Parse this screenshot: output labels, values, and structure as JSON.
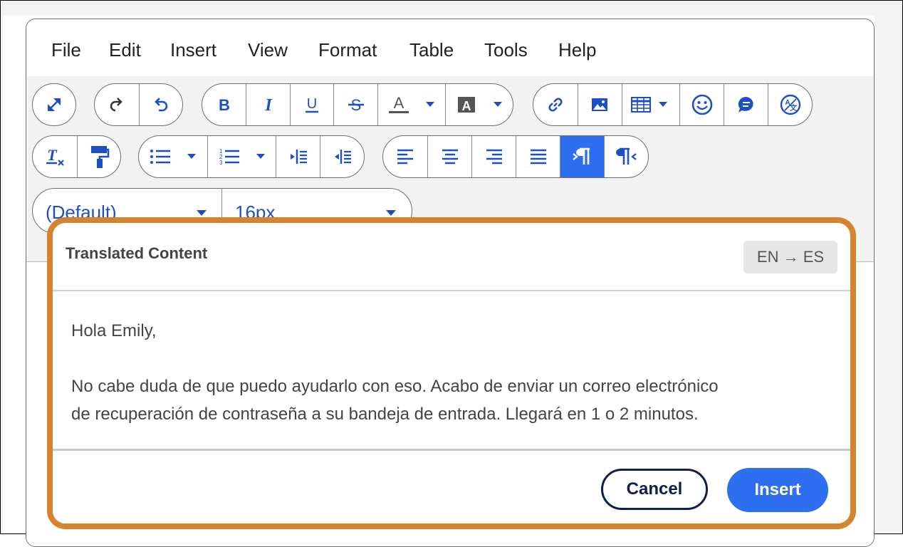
{
  "menu": {
    "items": [
      "File",
      "Edit",
      "Insert",
      "View",
      "Format",
      "Table",
      "Tools",
      "Help"
    ]
  },
  "toolbar": {
    "row1": [
      "fullscreen-icon",
      "redo-icon",
      "undo-icon",
      "bold-icon",
      "italic-icon",
      "underline-icon",
      "strikethrough-icon",
      "text-color-icon",
      "highlight-color-icon",
      "link-icon",
      "image-icon",
      "table-icon",
      "emoji-icon",
      "comment-icon",
      "translate-icon"
    ],
    "row2": [
      "clear-formatting-icon",
      "format-painter-icon",
      "bullet-list-icon",
      "numbered-list-icon",
      "indent-icon",
      "outdent-icon",
      "align-left-icon",
      "align-center-icon",
      "align-right-icon",
      "justify-icon",
      "ltr-icon",
      "rtl-icon"
    ],
    "font_family": "(Default)",
    "font_size": "16px",
    "active_button": "ltr-icon"
  },
  "dialog": {
    "title": "Translated Content",
    "language_badge": "EN → ES",
    "greeting": "Hola Emily,",
    "body_line1": "No cabe duda de que puedo ayudarlo con eso. Acabo de enviar un correo electrónico",
    "body_line2": "de recuperación de contraseña a su bandeja de entrada. Llegará en 1 o 2 minutos.",
    "cancel_label": "Cancel",
    "insert_label": "Insert"
  },
  "colors": {
    "accent": "#2d6ff0",
    "icon": "#1d4fc4",
    "dialog_border": "#d4832f",
    "cancel_border": "#0e1f4d"
  }
}
